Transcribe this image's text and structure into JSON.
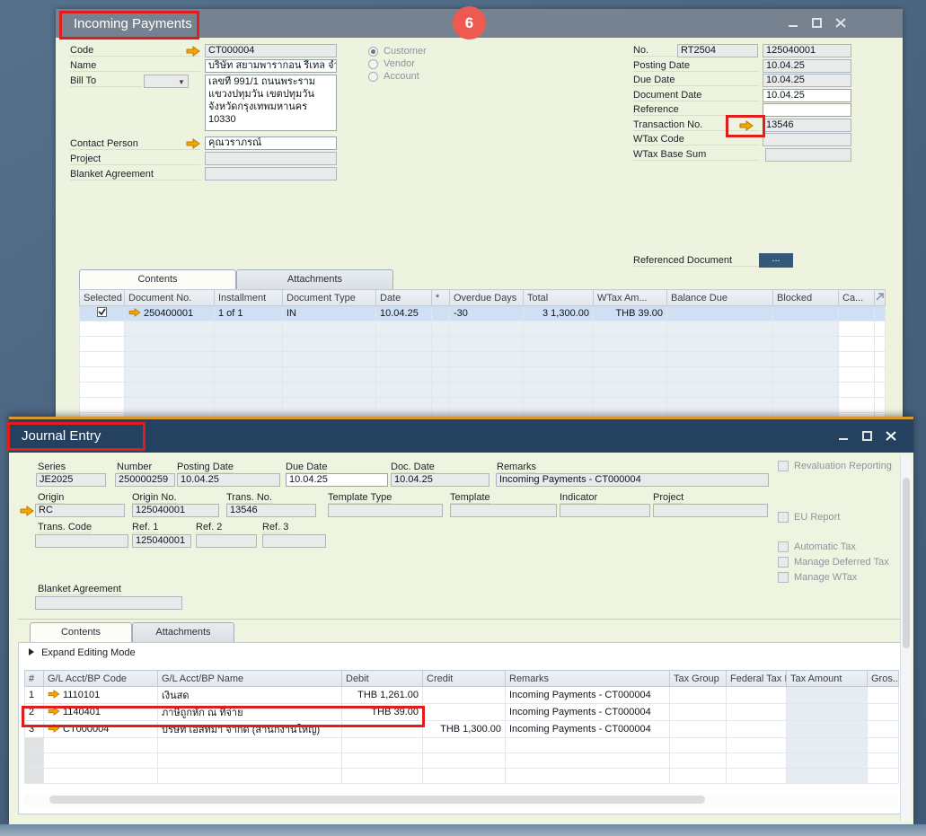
{
  "step_badge": "6",
  "incoming_payments": {
    "title": "Incoming Payments",
    "left": {
      "code_label": "Code",
      "code_value": "CT000004",
      "name_label": "Name",
      "name_value": "บริษัท สยามพารากอน รีเทล จำกั",
      "bill_to_label": "Bill To",
      "address_value": "เลขที่ 991/1 ถนนพระราม\nแขวงปทุมวัน เขตปทุมวัน\nจังหวัดกรุงเทพมหานคร 10330",
      "contact_person_label": "Contact Person",
      "contact_person_value": "คุณวราภรณ์",
      "project_label": "Project",
      "blanket_agreement_label": "Blanket Agreement"
    },
    "entity_radios": {
      "customer": "Customer",
      "vendor": "Vendor",
      "account": "Account"
    },
    "right": {
      "no_label": "No.",
      "series_value": "RT2504",
      "no_value": "125040001",
      "posting_date_label": "Posting Date",
      "posting_date_value": "10.04.25",
      "due_date_label": "Due Date",
      "due_date_value": "10.04.25",
      "document_date_label": "Document Date",
      "document_date_value": "10.04.25",
      "reference_label": "Reference",
      "transaction_no_label": "Transaction No.",
      "transaction_no_value": "13546",
      "wtax_code_label": "WTax Code",
      "wtax_base_sum_label": "WTax Base Sum",
      "referenced_document_label": "Referenced Document",
      "referenced_document_button": "..."
    },
    "tabs": {
      "contents": "Contents",
      "attachments": "Attachments"
    },
    "table": {
      "headers": [
        "Selected",
        "Document No.",
        "Installment",
        "Document Type",
        "Date",
        "*",
        "Overdue Days",
        "Total",
        "WTax Am...",
        "Balance Due",
        "Blocked",
        "Ca..."
      ],
      "row1": {
        "document_no": "250400001",
        "installment": "1 of 1",
        "document_type": "IN",
        "date": "10.04.25",
        "overdue_days": "-30",
        "total": "3 1,300.00",
        "wtax_amount": "THB 39.00"
      }
    }
  },
  "journal_entry": {
    "title": "Journal Entry",
    "header": {
      "series_label": "Series",
      "series_value": "JE2025",
      "number_label": "Number",
      "number_value": "250000259",
      "posting_date_label": "Posting Date",
      "posting_date_value": "10.04.25",
      "due_date_label": "Due Date",
      "due_date_value": "10.04.25",
      "doc_date_label": "Doc. Date",
      "doc_date_value": "10.04.25",
      "remarks_label": "Remarks",
      "remarks_value": "Incoming Payments - CT000004",
      "origin_label": "Origin",
      "origin_value": "RC",
      "origin_no_label": "Origin No.",
      "origin_no_value": "125040001",
      "trans_no_label": "Trans. No.",
      "trans_no_value": "13546",
      "template_type_label": "Template Type",
      "template_label": "Template",
      "indicator_label": "Indicator",
      "project_label": "Project",
      "trans_code_label": "Trans. Code",
      "ref1_label": "Ref. 1",
      "ref1_value": "125040001",
      "ref2_label": "Ref. 2",
      "ref3_label": "Ref. 3",
      "blanket_agreement_label": "Blanket Agreement"
    },
    "options": {
      "revaluation": "Revaluation Reporting",
      "eu_report": "EU Report",
      "automatic_tax": "Automatic Tax",
      "manage_deferred_tax": "Manage Deferred Tax",
      "manage_wtax": "Manage WTax"
    },
    "tabs": {
      "contents": "Contents",
      "attachments": "Attachments"
    },
    "expand_editing_mode": "Expand Editing Mode",
    "table": {
      "headers": [
        "#",
        "G/L Acct/BP Code",
        "G/L Acct/BP Name",
        "Debit",
        "Credit",
        "Remarks",
        "Tax Group",
        "Federal Tax ID",
        "Tax Amount",
        "Gros..."
      ],
      "rows": [
        {
          "num": "1",
          "code": "1110101",
          "name": "เงินสด",
          "debit": "THB 1,261.00",
          "credit": "",
          "remarks": "Incoming Payments - CT000004"
        },
        {
          "num": "2",
          "code": "1140401",
          "name": "ภาษีถูกหัก ณ ที่จ่าย",
          "debit": "THB 39.00",
          "credit": "",
          "remarks": "Incoming Payments - CT000004"
        },
        {
          "num": "3",
          "code": "CT000004",
          "name": "บริษัท เอสทิมา จำกัด (สำนักงานใหญ่)",
          "debit": "",
          "credit": "THB 1,300.00",
          "remarks": "Incoming Payments - CT000004"
        }
      ]
    }
  }
}
